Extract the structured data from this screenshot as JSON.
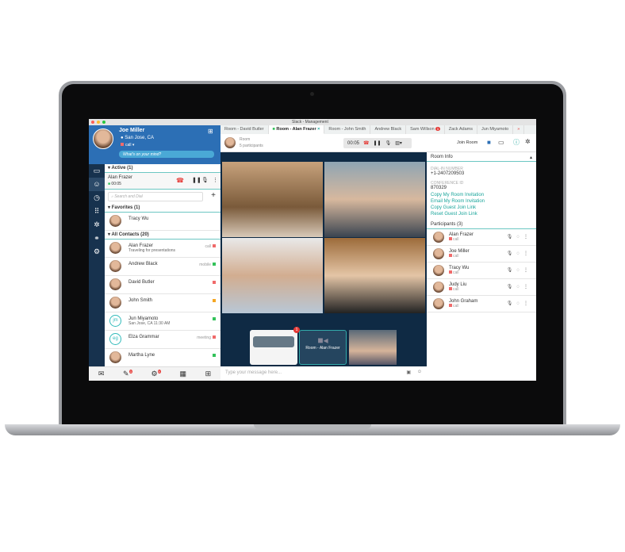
{
  "window_title": "Slack - Management",
  "profile": {
    "name": "Joe Miller",
    "location": "San Jose, CA",
    "status": "call",
    "mood_placeholder": "What's on your mind?"
  },
  "rail_icons": [
    "chat-icon",
    "contacts-icon",
    "history-icon",
    "dialpad-icon",
    "network-icon",
    "link-icon",
    "settings-icon"
  ],
  "active": {
    "header": "Active (1)",
    "caller": "Alan Frazer",
    "duration": "00:05"
  },
  "search": {
    "placeholder": "Search and Dial"
  },
  "favorites": {
    "header": "Favorites (1)",
    "items": [
      {
        "name": "Tracy Wu"
      }
    ]
  },
  "contacts": {
    "header": "All Contacts (20)",
    "items": [
      {
        "name": "Alan Frazer",
        "sub": "Traveling for presentations",
        "tag": "call",
        "color": "#f06a6a"
      },
      {
        "name": "Andrew Black",
        "sub": "",
        "tag": "mobile",
        "color": "#33c25a"
      },
      {
        "name": "David Butler",
        "sub": "",
        "tag": "",
        "color": "#f06a6a"
      },
      {
        "name": "John Smith",
        "sub": "",
        "tag": "",
        "color": "#f5a623"
      },
      {
        "name": "Jun Miyamoto",
        "sub": "San Jose, CA 11:30 AM",
        "tag": "",
        "color": "#33c25a",
        "initials": "jm"
      },
      {
        "name": "Elza Grammar",
        "sub": "",
        "tag": "meeting",
        "color": "#f06a6a",
        "initials": "eg"
      },
      {
        "name": "Martha Lyne",
        "sub": "",
        "tag": "",
        "color": "#33c25a"
      }
    ]
  },
  "bottom_badges": {
    "chat": "3",
    "voicemail": "9"
  },
  "tabs": [
    {
      "label": "Room - David Butler"
    },
    {
      "label": "Room - Alan Frazer",
      "active": true
    },
    {
      "label": "Room - John Smith"
    },
    {
      "label": "Andrew Black"
    },
    {
      "label": "Sam Willson",
      "badge": "1"
    },
    {
      "label": "Zack Adams"
    },
    {
      "label": "Jun Miyamoto"
    }
  ],
  "room": {
    "label": "Room",
    "participants": "5 participants",
    "timer": "00:05",
    "join_label": "Join Room"
  },
  "thumbs": {
    "badge": "1",
    "room_label": "Room - Alan Frazer"
  },
  "message": {
    "placeholder": "Type your message here..."
  },
  "room_info": {
    "title": "Room Info",
    "dial_in_label": "DIAL-IN NUMBER",
    "dial_in": "+1-2407209503",
    "conf_label": "CONFERENCE ID",
    "conf_id": "870329",
    "links": [
      "Copy My Room Invitation",
      "Email My Room Invitation",
      "Copy Guest Join Link",
      "Reset Guest Join Link"
    ],
    "participants_header": "Participants (3)",
    "participants": [
      {
        "name": "Alan Frazer",
        "status": "call"
      },
      {
        "name": "Joe Miller",
        "status": "call"
      },
      {
        "name": "Tracy Wu",
        "status": "call"
      },
      {
        "name": "Judy Liu",
        "status": "call"
      },
      {
        "name": "John Graham",
        "status": "call"
      }
    ]
  },
  "colors": {
    "accent": "#1aa59b",
    "profile_bg": "#2c6fb5",
    "rail": "#17324e",
    "stage": "#0f2a44",
    "hangup": "#e53935"
  }
}
